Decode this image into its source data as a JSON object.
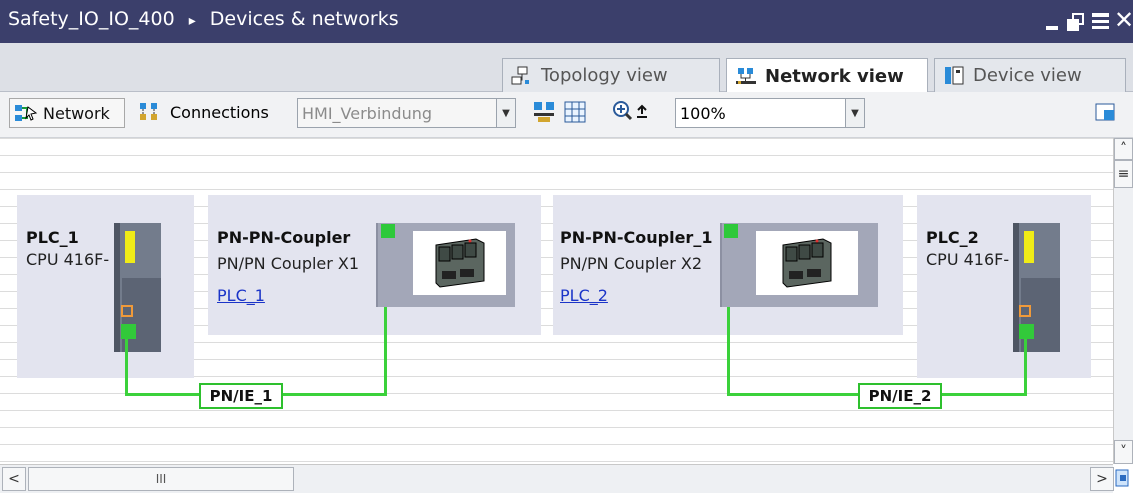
{
  "window": {
    "title": "Safety_IO_IO_400",
    "separator": "▸",
    "subtitle": "Devices & networks",
    "controls": [
      "minimize-icon",
      "restore-icon",
      "maximize-icon",
      "close-icon"
    ]
  },
  "tabs": [
    {
      "label": "Topology view",
      "icon": "topology-icon",
      "active": false
    },
    {
      "label": "Network view",
      "icon": "network-icon",
      "active": true
    },
    {
      "label": "Device view",
      "icon": "device-icon",
      "active": false
    }
  ],
  "toolbar": {
    "network_label": "Network",
    "connections_label": "Connections",
    "connection_type_value": "HMI_Verbindung",
    "zoom_value": "100%"
  },
  "devices": [
    {
      "name": "PLC_1",
      "type": "CPU 416F-",
      "link": ""
    },
    {
      "name": "PN-PN-Coupler",
      "type": "PN/PN Coupler X1",
      "link": "PLC_1"
    },
    {
      "name": "PN-PN-Coupler_1",
      "type": "PN/PN Coupler X2",
      "link": "PLC_2"
    },
    {
      "name": "PLC_2",
      "type": "CPU 416F-",
      "link": ""
    }
  ],
  "subnets": [
    {
      "label": "PN/IE_1"
    },
    {
      "label": "PN/IE_2"
    }
  ],
  "colors": {
    "titlebar": "#3b3f6b",
    "device_bg": "#e3e4ef",
    "network_line": "#3bd13b",
    "link": "#1b34c8"
  },
  "scroll": {
    "grip": "III"
  }
}
